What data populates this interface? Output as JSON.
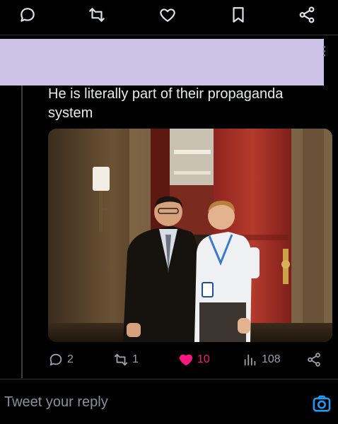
{
  "top_actions": {
    "icons": [
      "reply-icon",
      "retweet-icon",
      "like-icon",
      "bookmark-icon",
      "share-icon"
    ]
  },
  "tweet": {
    "text": "He is literally part of their propaganda system",
    "image_alt": "Two men posing in front of a red door",
    "stats": {
      "replies": "2",
      "retweets": "1",
      "likes": "10",
      "views": "108"
    },
    "like_color": "#f91880",
    "redaction_color": "#cbc3e7"
  },
  "reply": {
    "placeholder": "Tweet your reply",
    "camera_icon": "camera-icon",
    "accent": "#1d9bf0"
  }
}
